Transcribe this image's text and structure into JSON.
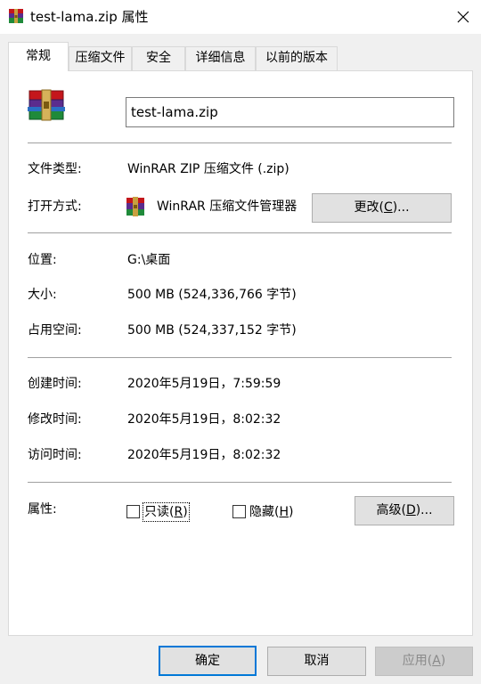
{
  "window": {
    "title": "test-lama.zip 属性",
    "close_glyph": "✕"
  },
  "tabs": [
    {
      "label": "常规",
      "active": true
    },
    {
      "label": "压缩文件",
      "active": false
    },
    {
      "label": "安全",
      "active": false
    },
    {
      "label": "详细信息",
      "active": false
    },
    {
      "label": "以前的版本",
      "active": false
    }
  ],
  "general": {
    "file_name": "test-lama.zip",
    "file_type_label": "文件类型:",
    "file_type_value": "WinRAR ZIP 压缩文件 (.zip)",
    "open_with_label": "打开方式:",
    "open_with_value": "WinRAR 压缩文件管理器",
    "change_button": {
      "text": "更改(",
      "key": "C",
      "suffix": ")..."
    },
    "location_label": "位置:",
    "location_value": "G:\\桌面",
    "size_label": "大小:",
    "size_value": "500 MB (524,336,766 字节)",
    "size_on_disk_label": "占用空间:",
    "size_on_disk_value": "500 MB (524,337,152 字节)",
    "created_label": "创建时间:",
    "created_value": "2020年5月19日，7:59:59",
    "modified_label": "修改时间:",
    "modified_value": "2020年5月19日，8:02:32",
    "accessed_label": "访问时间:",
    "accessed_value": "2020年5月19日，8:02:32",
    "attributes_label": "属性:",
    "readonly": {
      "text": "只读(",
      "key": "R",
      "suffix": ")",
      "checked": false
    },
    "hidden": {
      "text": "隐藏(",
      "key": "H",
      "suffix": ")",
      "checked": false
    },
    "advanced_button": {
      "text": "高级(",
      "key": "D",
      "suffix": ")..."
    }
  },
  "footer": {
    "ok_label": "确定",
    "cancel_label": "取消",
    "apply_button": {
      "text": "应用(",
      "key": "A",
      "suffix": ")"
    }
  },
  "icons": {
    "app_icon": "winrar-archive-icon",
    "colors": {
      "red": "#c4161c",
      "purple": "#5b2c8e",
      "green": "#1f8a3a",
      "blue": "#1f5fb4",
      "gold": "#c8a040"
    }
  },
  "colors": {
    "accent": "#0078d7",
    "panel": "#ffffff",
    "window": "#f0f0f0"
  }
}
